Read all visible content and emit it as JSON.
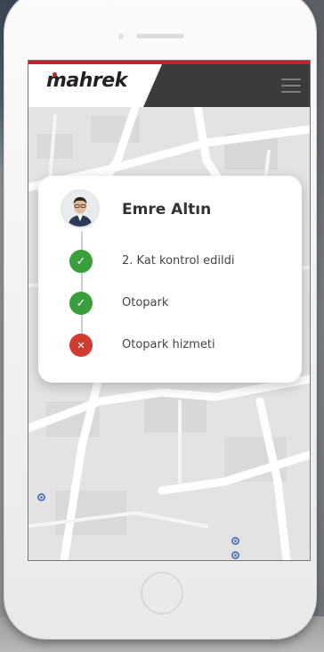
{
  "app": {
    "logo": "mahrek",
    "logo_subtitle": "",
    "accent_color": "#c3232d",
    "navbar_color": "#3a3b3d"
  },
  "navbar": {
    "menu_icon": "hamburger-menu-icon"
  },
  "card": {
    "user_name": "Emre Altın",
    "steps": [
      {
        "label": "2. Kat kontrol edildi",
        "status": "success",
        "icon": "check-icon",
        "color": "#3a9e3c"
      },
      {
        "label": "Otopark",
        "status": "success",
        "icon": "check-icon",
        "color": "#3a9e3c"
      },
      {
        "label": "Otopark hizmeti",
        "status": "failed",
        "icon": "x-icon",
        "color": "#d23b31"
      }
    ]
  },
  "map": {
    "icons": [
      "food-pin-icon",
      "place-marker-icon"
    ]
  }
}
